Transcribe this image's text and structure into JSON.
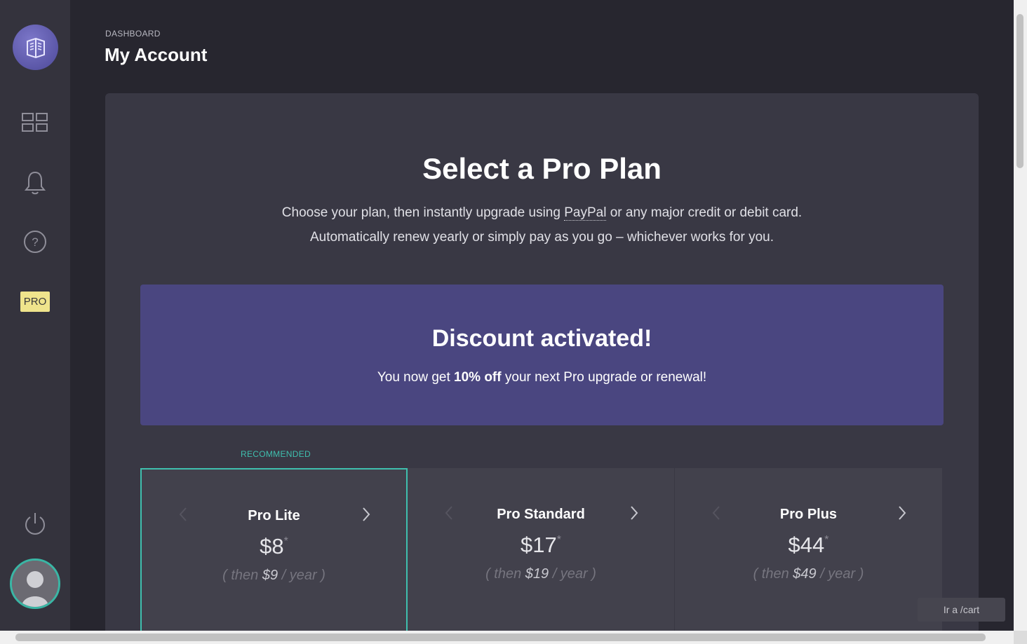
{
  "sidebar": {
    "logo_icon": "book-logo-icon",
    "items": [
      {
        "name": "dashboard",
        "icon": "grid-icon"
      },
      {
        "name": "notifications",
        "icon": "bell-icon"
      },
      {
        "name": "help",
        "icon": "question-icon"
      }
    ],
    "pro_badge": "PRO",
    "power_icon": "power-icon",
    "avatar_icon": "user-avatar-icon"
  },
  "header": {
    "breadcrumb": "DASHBOARD",
    "title": "My Account"
  },
  "panel": {
    "title": "Select a Pro Plan",
    "subtitle_line1_before": "Choose your plan, then instantly upgrade using ",
    "subtitle_link": "PayPal",
    "subtitle_line1_after": " or any major credit or debit card.",
    "subtitle_line2": "Automatically renew yearly or simply pay as you go – whichever works for you."
  },
  "discount": {
    "title": "Discount activated!",
    "text_before": "You now get ",
    "text_bold": "10% off",
    "text_after": " your next Pro upgrade or renewal!"
  },
  "recommended_label": "RECOMMENDED",
  "plans": [
    {
      "name": "Pro Lite",
      "price": "$8",
      "asterisk": "*",
      "then_open": "( then ",
      "then_price": "$9",
      "then_close": " / year )"
    },
    {
      "name": "Pro Standard",
      "price": "$17",
      "asterisk": "*",
      "then_open": "( then ",
      "then_price": "$19",
      "then_close": " / year )"
    },
    {
      "name": "Pro Plus",
      "price": "$44",
      "asterisk": "*",
      "then_open": "( then ",
      "then_price": "$49",
      "then_close": " / year )"
    }
  ],
  "cart_button": "Ir a /cart",
  "colors": {
    "accent": "#3fbfae",
    "discount_bg": "#4a4680",
    "pro_badge": "#efe48c"
  }
}
